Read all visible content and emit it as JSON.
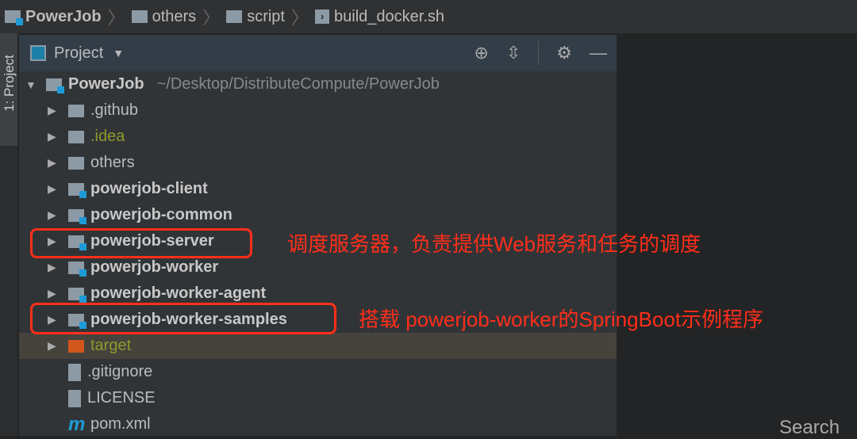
{
  "breadcrumb": [
    "PowerJob",
    "others",
    "script",
    "build_docker.sh"
  ],
  "side_tab": "1: Project",
  "panel": {
    "title": "Project"
  },
  "tree": [
    {
      "label": "PowerJob",
      "extra": "~/Desktop/DistributeCompute/PowerJob",
      "type": "module",
      "open": true,
      "depth": 0
    },
    {
      "label": ".github",
      "type": "folder",
      "depth": 1
    },
    {
      "label": ".idea",
      "type": "folder",
      "depth": 1,
      "style": "olive"
    },
    {
      "label": "others",
      "type": "folder",
      "depth": 1
    },
    {
      "label": "powerjob-client",
      "type": "module",
      "depth": 1
    },
    {
      "label": "powerjob-common",
      "type": "module",
      "depth": 1
    },
    {
      "label": "powerjob-server",
      "type": "module",
      "depth": 1
    },
    {
      "label": "powerjob-worker",
      "type": "module",
      "depth": 1
    },
    {
      "label": "powerjob-worker-agent",
      "type": "module",
      "depth": 1
    },
    {
      "label": "powerjob-worker-samples",
      "type": "module",
      "depth": 1
    },
    {
      "label": "target",
      "type": "excluded",
      "depth": 1,
      "style": "olive"
    },
    {
      "label": ".gitignore",
      "type": "file",
      "depth": 1
    },
    {
      "label": "LICENSE",
      "type": "file",
      "depth": 1
    },
    {
      "label": "pom.xml",
      "type": "maven",
      "depth": 1
    }
  ],
  "annotations": [
    "调度服务器，负责提供Web服务和任务的调度",
    "搭载 powerjob-worker的SpringBoot示例程序"
  ],
  "search_text": "Search"
}
